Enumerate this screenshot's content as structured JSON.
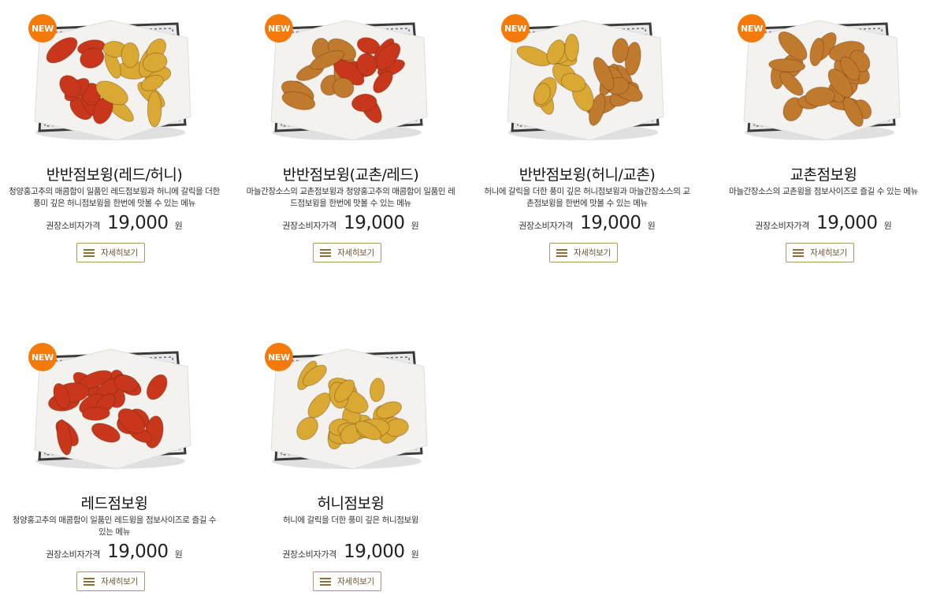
{
  "menu": {
    "items": [
      {
        "badge": "NEW",
        "name": "반반점보윙(레드/허니)",
        "desc": "청양홍고추의 매콤함이 일품인 레드점보윙과 허니에 갈릭을 더한 풍미 깊은 허니점보윙을 한번에 맛볼 수 있는 메뉴",
        "price_label": "권장소비자가격",
        "price": "19,000",
        "price_unit": "원",
        "more_label": "자세히보기",
        "image": "chicken-half-red-honey"
      },
      {
        "badge": "NEW",
        "name": "반반점보윙(교촌/레드)",
        "desc": "마늘간장소스의 교촌점보윙과 청양홍고추의 매콤함이 일품인 레드점보윙을 한번에 맛볼 수 있는 메뉴",
        "price_label": "권장소비자가격",
        "price": "19,000",
        "price_unit": "원",
        "more_label": "자세히보기",
        "image": "chicken-half-kyochon-red"
      },
      {
        "badge": "NEW",
        "name": "반반점보윙(허니/교촌)",
        "desc": "허니에 갈릭을 더한 풍미 깊은 허니점보윙과 마늘간장소스의 교촌점보윙을 한번에 맛볼 수 있는 메뉴",
        "price_label": "권장소비자가격",
        "price": "19,000",
        "price_unit": "원",
        "more_label": "자세히보기",
        "image": "chicken-half-honey-kyochon"
      },
      {
        "badge": "NEW",
        "name": "교촌점보윙",
        "desc": "마늘간장소스의 교촌윙을 점보사이즈로 즐길 수 있는 메뉴",
        "price_label": "권장소비자가격",
        "price": "19,000",
        "price_unit": "원",
        "more_label": "자세히보기",
        "image": "chicken-kyochon"
      },
      {
        "badge": "NEW",
        "name": "레드점보윙",
        "desc": "청양홍고추의 매콤함이 일품인 레드윙을 점보사이즈로 즐길 수 있는 메뉴",
        "price_label": "권장소비자가격",
        "price": "19,000",
        "price_unit": "원",
        "more_label": "자세히보기",
        "image": "chicken-red"
      },
      {
        "badge": "NEW",
        "name": "허니점보윙",
        "desc": "허니에 갈릭을 더한 풍미 깊은 허니점보윙",
        "price_label": "권장소비자가격",
        "price": "19,000",
        "price_unit": "원",
        "more_label": "자세히보기",
        "image": "chicken-honey"
      }
    ]
  },
  "colors": {
    "badge": "#f47a0b",
    "button_border": "#b29565",
    "red_wing": "#c8361c",
    "honey_wing": "#d9a934",
    "kyochon_wing": "#c07a2e"
  }
}
